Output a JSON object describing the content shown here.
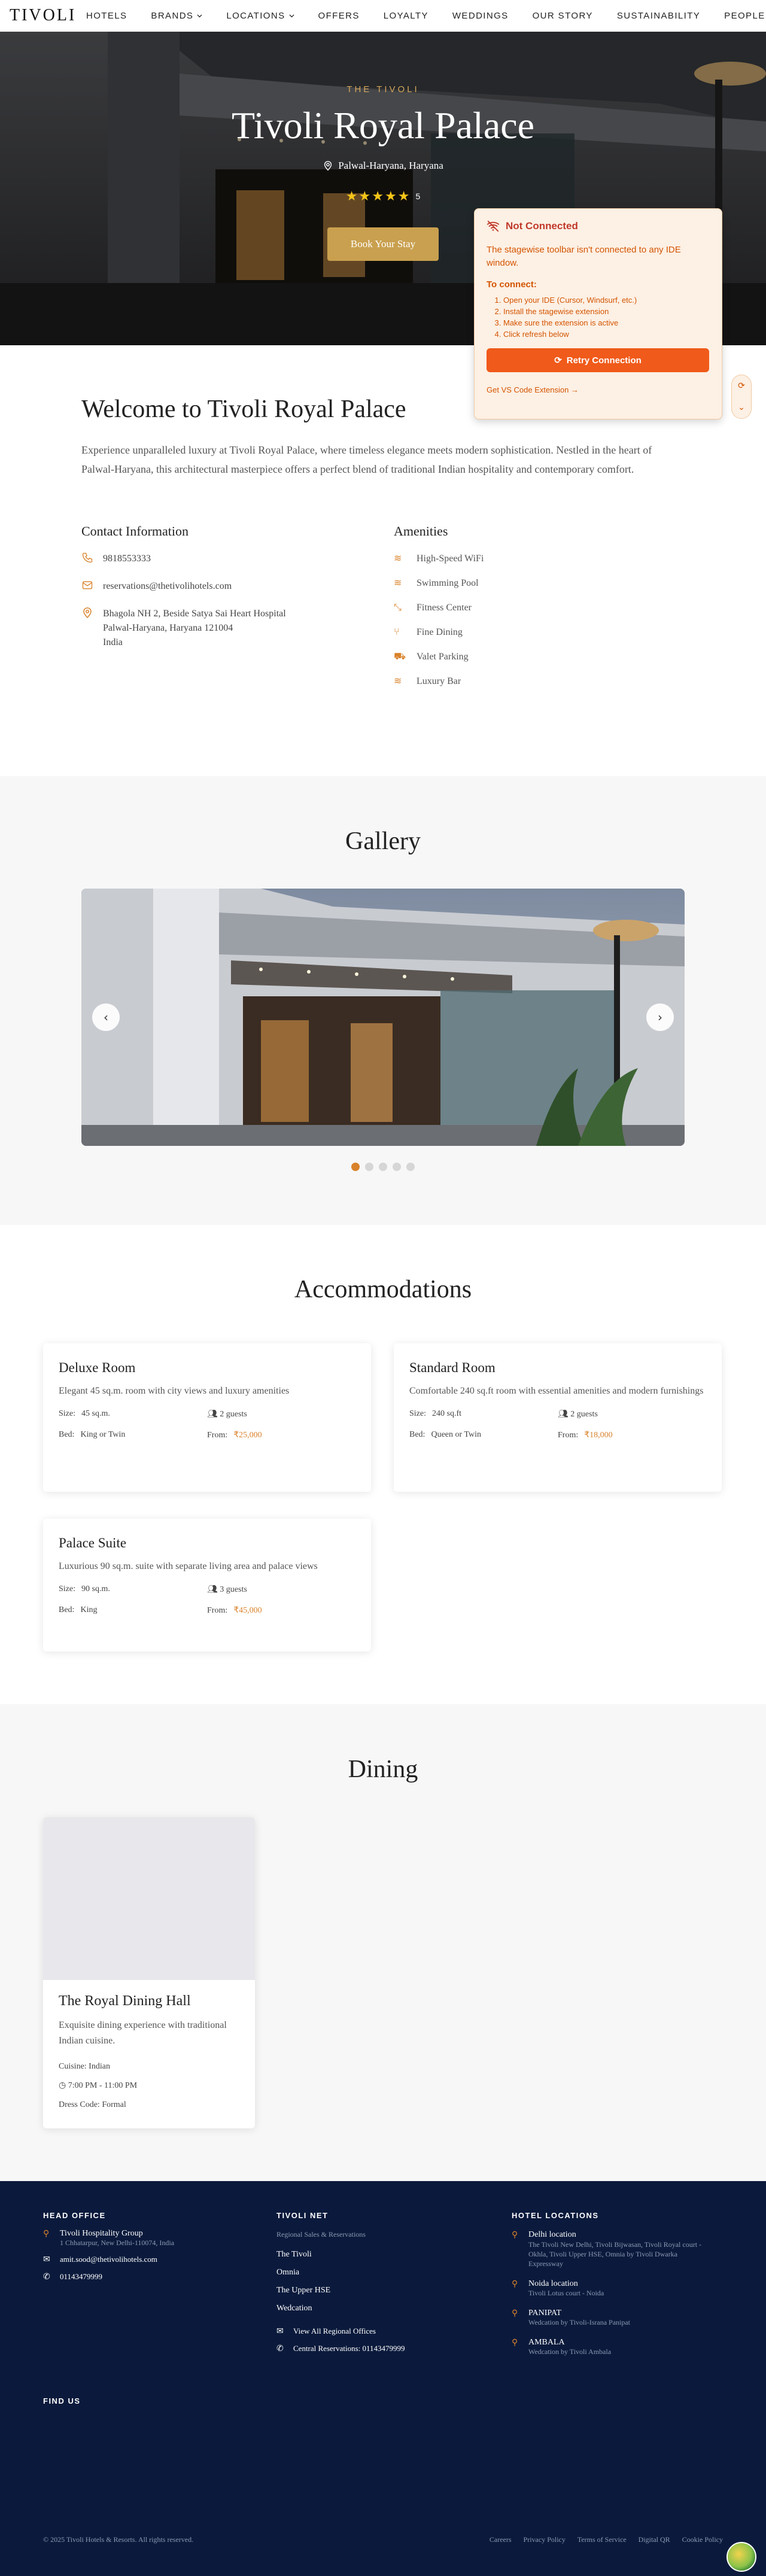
{
  "nav": {
    "logo": "TIVOLI",
    "items": [
      "HOTELS",
      "BRANDS",
      "LOCATIONS",
      "OFFERS",
      "LOYALTY",
      "WEDDINGS",
      "OUR STORY",
      "SUSTAINABILITY",
      "PEOPLE"
    ]
  },
  "hero": {
    "kicker": "THE TIVOLI",
    "title": "Tivoli Royal Palace",
    "location": "Palwal-Haryana, Haryana",
    "stars": 5,
    "rating_text": "5",
    "book_label": "Book Your Stay"
  },
  "popup": {
    "title": "Not Connected",
    "description": "The stagewise toolbar isn't connected to any IDE window.",
    "to_connect": "To connect:",
    "steps": [
      "Open your IDE (Cursor, Windsurf, etc.)",
      "Install the stagewise extension",
      "Make sure the extension is active",
      "Click refresh below"
    ],
    "retry_label": "Retry Connection",
    "link": "Get VS Code Extension →"
  },
  "welcome": {
    "title": "Welcome to Tivoli Royal Palace",
    "text": "Experience unparalleled luxury at Tivoli Royal Palace, where timeless elegance meets modern sophistication. Nestled in the heart of Palwal-Haryana, this architectural masterpiece offers a perfect blend of traditional Indian hospitality and contemporary comfort."
  },
  "contact": {
    "title": "Contact Information",
    "phone": "9818553333",
    "email": "reservations@thetivolihotels.com",
    "address_line1": "Bhagola NH 2, Beside Satya Sai Heart Hospital",
    "address_line2": "Palwal-Haryana, Haryana 121004",
    "address_line3": "India"
  },
  "amenities": {
    "title": "Amenities",
    "items": [
      "High-Speed WiFi",
      "Swimming Pool",
      "Fitness Center",
      "Fine Dining",
      "Valet Parking",
      "Luxury Bar"
    ]
  },
  "gallery": {
    "title": "Gallery",
    "active_slide": 1,
    "slide_count": 5
  },
  "accommodations": {
    "title": "Accommodations",
    "rooms": [
      {
        "name": "Deluxe Room",
        "desc": "Elegant 45 sq.m. room with city views and luxury amenities",
        "size_label": "Size:",
        "size": "45 sq.m.",
        "guests": "2 guests",
        "bed_label": "Bed:",
        "bed": "King or Twin",
        "from_label": "From:",
        "price": "₹25,000"
      },
      {
        "name": "Standard Room",
        "desc": "Comfortable 240 sq.ft room with essential amenities and modern furnishings",
        "size_label": "Size:",
        "size": "240 sq.ft",
        "guests": "2 guests",
        "bed_label": "Bed:",
        "bed": "Queen or Twin",
        "from_label": "From:",
        "price": "₹18,000"
      },
      {
        "name": "Palace Suite",
        "desc": "Luxurious 90 sq.m. suite with separate living area and palace views",
        "size_label": "Size:",
        "size": "90 sq.m.",
        "guests": "3 guests",
        "bed_label": "Bed:",
        "bed": "King",
        "from_label": "From:",
        "price": "₹45,000"
      }
    ]
  },
  "dining": {
    "title": "Dining",
    "name": "The Royal Dining Hall",
    "desc": "Exquisite dining experience with traditional Indian cuisine.",
    "cuisine_label": "Cuisine:",
    "cuisine": "Indian",
    "hours": "7:00 PM - 11:00 PM",
    "dress_label": "Dress Code:",
    "dress": "Formal"
  },
  "footer": {
    "head_office_title": "HEAD OFFICE",
    "group_name": "Tivoli Hospitality Group",
    "group_addr": "1 Chhatarpur, New Delhi-110074, India",
    "email": "amit.sood@thetivolihotels.com",
    "phone": "01143479999",
    "net_title": "TIVOLI NET",
    "net_sub": "Regional Sales & Reservations",
    "net_links": [
      "The Tivoli",
      "Omnia",
      "The Upper HSE",
      "Wedcation"
    ],
    "regional_offices": "View All Regional Offices",
    "central_res": "Central Reservations: 01143479999",
    "locations_title": "HOTEL LOCATIONS",
    "locations": [
      {
        "name": "Delhi location",
        "sub": "The Tivoli New Delhi, Tivoli Bijwasan, Tivoli Royal court - Okhla, Tivoli Upper HSE, Omnia by Tivoli Dwarka Expressway"
      },
      {
        "name": "Noida location",
        "sub": "Tivoli Lotus court - Noida"
      },
      {
        "name": "PANIPAT",
        "sub": "Wedcation by Tivoli-Israna Panipat"
      },
      {
        "name": "AMBALA",
        "sub": "Wedcation by Tivoli Ambala"
      }
    ],
    "find_us": "FIND US",
    "copyright": "© 2025 Tivoli Hotels & Resorts. All rights reserved.",
    "links": [
      "Careers",
      "Privacy Policy",
      "Terms of Service",
      "Digital QR",
      "Cookie Policy"
    ]
  }
}
